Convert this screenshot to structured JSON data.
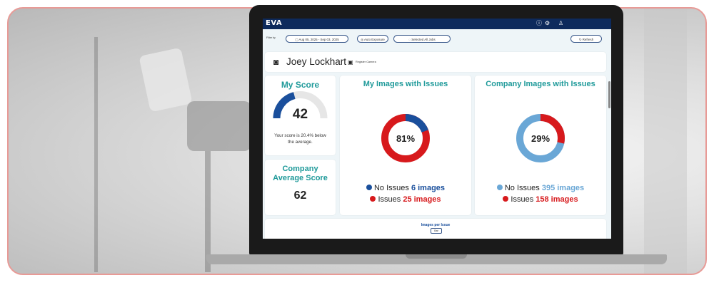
{
  "app": {
    "logo": "EVA"
  },
  "filters": {
    "label": "Filter by",
    "date_range": "Aug 05, 2025 - Sep 03, 2025",
    "auto_exposure": "Auto Exposure",
    "selected_jobs": "Selected All Jobs",
    "refresh": "Refresh"
  },
  "profile": {
    "name": "Joey Lockhart",
    "register_camera": "Register Camera"
  },
  "my_score": {
    "title": "My Score",
    "value": "42",
    "score_fraction": 0.42,
    "note": "Your score is 20.4% below the average."
  },
  "company_avg": {
    "title": "Company Average Score",
    "value": "62"
  },
  "my_images": {
    "title": "My Images with Issues",
    "percent_label": "81%",
    "no_issues_label": "No Issues",
    "no_issues_count": "6 images",
    "issues_label": "Issues",
    "issues_count": "25 images",
    "no_issues_value": 6,
    "issues_value": 25
  },
  "company_images": {
    "title": "Company Images with Issues",
    "percent_label": "29%",
    "no_issues_label": "No Issues",
    "no_issues_count": "395 images",
    "issues_label": "Issues",
    "issues_count": "158 images",
    "no_issues_value": 395,
    "issues_value": 158
  },
  "images_per_issue": {
    "title": "Images per Issue",
    "toggle": "Bar"
  },
  "colors": {
    "navy": "#0d2a5c",
    "blue": "#1a4f9c",
    "light_blue": "#6aa7d6",
    "red": "#d7191c",
    "teal": "#1f9a9a"
  }
}
